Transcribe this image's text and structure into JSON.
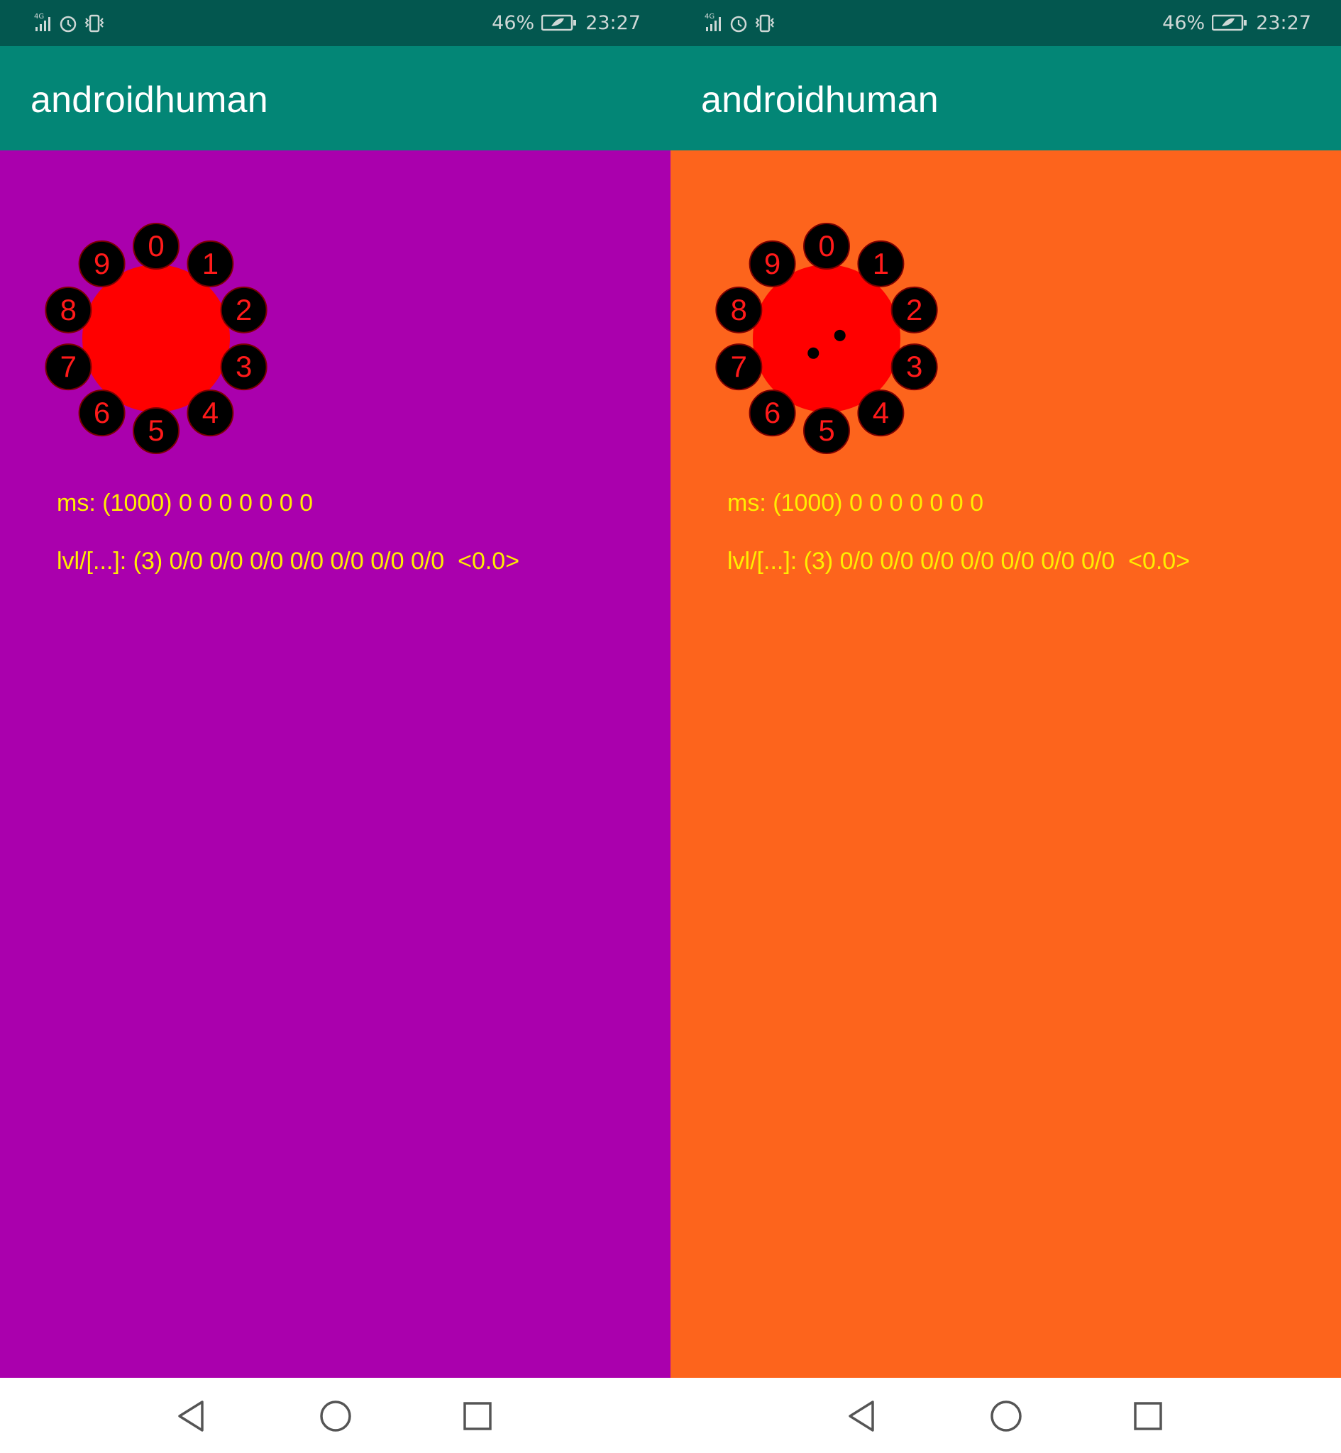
{
  "screens": [
    {
      "status": {
        "network": "4G",
        "battery_percent": "46%",
        "time": "23:27"
      },
      "app_title": "androidhuman",
      "background": "#aa00ad",
      "dial_digits": [
        "0",
        "1",
        "2",
        "3",
        "4",
        "5",
        "6",
        "7",
        "8",
        "9"
      ],
      "dial_dots": [],
      "ms_line": "ms: (1000) 0 0 0 0 0 0 0",
      "lvl_line": "lvl/[...]: (3) 0/0 0/0 0/0 0/0 0/0 0/0 0/0  <0.0>"
    },
    {
      "status": {
        "network": "4G",
        "battery_percent": "46%",
        "time": "23:27"
      },
      "app_title": "androidhuman",
      "background": "#fd641c",
      "dial_digits": [
        "0",
        "1",
        "2",
        "3",
        "4",
        "5",
        "6",
        "7",
        "8",
        "9"
      ],
      "dial_dots": [
        {
          "dx": -0.09,
          "dy": 0.1
        },
        {
          "dx": 0.09,
          "dy": -0.02
        }
      ],
      "ms_line": "ms: (1000) 0 0 0 0 0 0 0",
      "lvl_line": "lvl/[...]: (3) 0/0 0/0 0/0 0/0 0/0 0/0 0/0  <0.0>"
    }
  ],
  "colors": {
    "status_bar": "#03574f",
    "app_bar": "#038676",
    "dial_face": "#ff0000",
    "digit_circle": "#000000",
    "digit_text": "#ff1a1a",
    "info_text": "#ffee00"
  },
  "nav": {
    "back_icon": "back-triangle-icon",
    "home_icon": "home-circle-icon",
    "recent_icon": "recent-square-icon"
  }
}
